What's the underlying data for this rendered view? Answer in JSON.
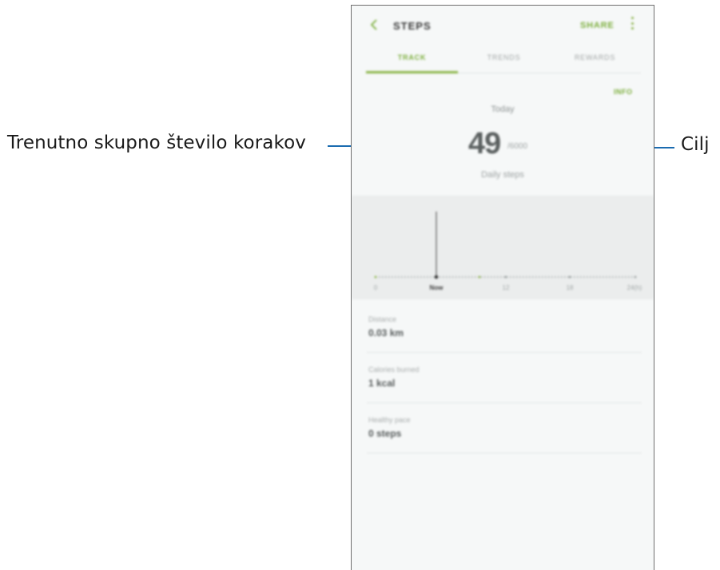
{
  "callouts": {
    "left": "Trenutno skupno število korakov",
    "right": "Cilj"
  },
  "app": {
    "title": "STEPS",
    "share": "SHARE",
    "back_icon": "back-chevron-icon",
    "more_icon": "more-vert-icon",
    "accent": "#7cae3c"
  },
  "tabs": [
    {
      "label": "TRACK",
      "active": true
    },
    {
      "label": "TRENDS",
      "active": false
    },
    {
      "label": "REWARDS",
      "active": false
    }
  ],
  "info_button": "INFO",
  "today": "Today",
  "steps": {
    "count": "49",
    "goal": "/6000",
    "daily_label": "Daily steps"
  },
  "chart_data": {
    "type": "bar",
    "x_ticks": [
      "0",
      "Now",
      "12",
      "18",
      "24(h)"
    ],
    "current_marker": "Now"
  },
  "stats": [
    {
      "label": "Distance",
      "value": "0.03 km"
    },
    {
      "label": "Calories burned",
      "value": "1 kcal"
    },
    {
      "label": "Healthy pace",
      "value": "0 steps"
    }
  ]
}
